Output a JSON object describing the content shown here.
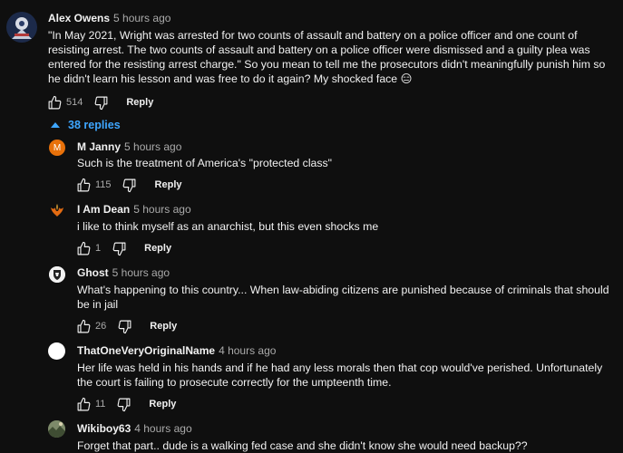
{
  "colors": {
    "background": "#0f0f0f",
    "text": "#f1f1f1",
    "secondary": "#aaaaaa",
    "link": "#3ea6ff"
  },
  "top_comment": {
    "author": "Alex Owens",
    "time": "5 hours ago",
    "text": "\"In May 2021, Wright was arrested for two counts of assault and battery on a police officer and one count of resisting arrest. The two counts of assault and battery on a police officer were dismissed and a guilty plea was entered for the resisting arrest charge.\" So you mean to tell me the prosecutors didn't meaningfully punish him so he didn't learn his lesson and was free to do it again? My shocked face 😑",
    "likes": "514",
    "reply_label": "Reply",
    "avatar_icon": "patch-badge-icon"
  },
  "replies_toggle": {
    "label": "38 replies",
    "icon": "caret-up-icon"
  },
  "replies": [
    {
      "author": "M Janny",
      "time": "5 hours ago",
      "text": "Such is the treatment of America's \"protected class\"",
      "likes": "115",
      "reply_label": "Reply",
      "avatar_letter": "M",
      "avatar_color": "#e8710a"
    },
    {
      "author": "I Am Dean",
      "time": "5 hours ago",
      "text": "i like to think myself as an anarchist, but this even shocks me",
      "likes": "1",
      "reply_label": "Reply",
      "avatar_icon": "phoenix-icon"
    },
    {
      "author": "Ghost",
      "time": "5 hours ago",
      "text": "What's happening to this country... When law-abiding citizens are punished because of  criminals that should be in jail",
      "likes": "26",
      "reply_label": "Reply",
      "avatar_icon": "crest-icon"
    },
    {
      "author": "ThatOneVeryOriginalName",
      "time": "4 hours ago",
      "text": "Her life was held in his hands and if he had any less morals then that cop would've perished. Unfortunately the court is failing to prosecute correctly for the umpteenth time.",
      "likes": "11",
      "reply_label": "Reply",
      "avatar_color": "#ffffff"
    },
    {
      "author": "Wikiboy63",
      "time": "4 hours ago",
      "text": "Forget that part.. dude is a walking fed case and she didn't know she would need backup??",
      "avatar_icon": "landscape-photo-icon"
    }
  ]
}
